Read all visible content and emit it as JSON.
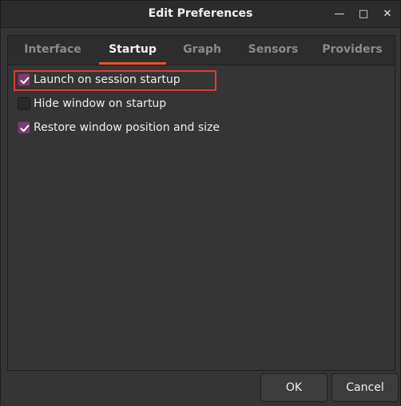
{
  "window": {
    "title": "Edit Preferences",
    "minimize_glyph": "—",
    "maximize_glyph": "□",
    "close_glyph": "✕"
  },
  "tabs": [
    {
      "label": "Interface",
      "active": false
    },
    {
      "label": "Startup",
      "active": true
    },
    {
      "label": "Graph",
      "active": false
    },
    {
      "label": "Sensors",
      "active": false
    },
    {
      "label": "Providers",
      "active": false
    }
  ],
  "startup": {
    "options": [
      {
        "label": "Launch on session startup",
        "checked": true
      },
      {
        "label": "Hide window on startup",
        "checked": false
      },
      {
        "label": "Restore window position and size",
        "checked": true
      }
    ]
  },
  "buttons": {
    "ok_label": "OK",
    "cancel_label": "Cancel"
  },
  "colors": {
    "accent": "#e95420",
    "checkbox_checked": "#7c3e6d",
    "focus_outline": "#e03a3a"
  }
}
